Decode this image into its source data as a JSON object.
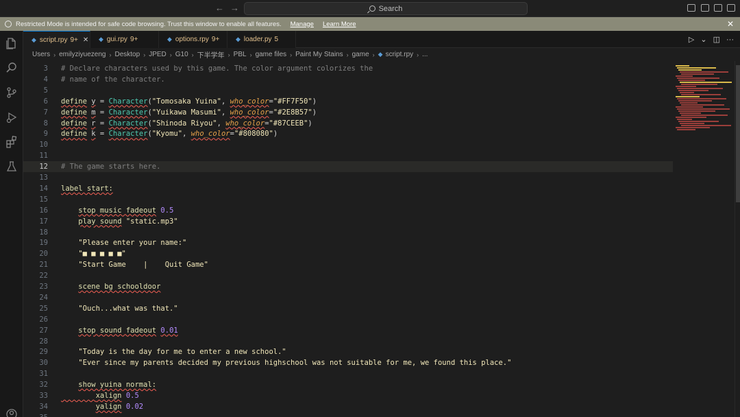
{
  "window": {
    "search_placeholder": "Search",
    "nav_back_glyph": "←",
    "nav_forward_glyph": "→"
  },
  "banner": {
    "message": "Restricted Mode is intended for safe code browsing. Trust this window to enable all features.",
    "manage_label": "Manage",
    "learn_more_label": "Learn More",
    "close_glyph": "✕",
    "color": "#8a8a78"
  },
  "activity_bar": {
    "icons": [
      "explorer-icon",
      "search-icon",
      "source-control-icon",
      "run-debug-icon",
      "extensions-icon",
      "testing-icon",
      "accounts-icon"
    ]
  },
  "tabs": [
    {
      "name": "script.rpy",
      "badge": "9+",
      "active": true,
      "close": "✕"
    },
    {
      "name": "gui.rpy",
      "badge": "9+",
      "active": false
    },
    {
      "name": "options.rpy",
      "badge": "9+",
      "active": false
    },
    {
      "name": "loader.py",
      "badge": "5",
      "active": false
    }
  ],
  "editor_actions": {
    "run_glyph": "▷",
    "dropdown_glyph": "⌄",
    "split_glyph": "◫",
    "more_glyph": "···"
  },
  "breadcrumb": [
    "Users",
    "emilyziyuezeng",
    "Desktop",
    "JPED",
    "G10",
    "下半学年",
    "PBL",
    "game files",
    "Paint My Stains",
    "game",
    "script.rpy",
    "..."
  ],
  "code": {
    "current_line": 12,
    "lines": [
      {
        "n": "3",
        "html": "<span class='t-cmt'># Declare characters used by this game. The color argument colorizes the</span>"
      },
      {
        "n": "4",
        "html": "<span class='t-cmt'># name of the character.</span>"
      },
      {
        "n": "5",
        "html": ""
      },
      {
        "n": "6",
        "html": "<span class='t-kw sq'>define</span> <span class='sq'>y</span> = <span class='t-cls sq'>Character</span>(<span class='t-str'>\"Tomosaka Yuina\"</span>, <span class='t-param sq'>who_color</span>=<span class='t-str'>\"#FF7F50\"</span>)"
      },
      {
        "n": "7",
        "html": "<span class='t-kw sq'>define</span> <span class='sq'>m</span> = <span class='t-cls sq'>Character</span>(<span class='t-str'>\"Yuikawa Masumi\"</span>, <span class='t-param sq'>who_color</span>=<span class='t-str'>\"#2E8B57\"</span>)"
      },
      {
        "n": "8",
        "html": "<span class='t-kw sq'>define</span> <span class='sq'>r</span> = <span class='t-cls sq'>Character</span>(<span class='t-str'>\"Shinoda Riyou\"</span>, <span class='t-param sq'>who_color</span>=<span class='t-str'>\"#87CEEB\"</span>)"
      },
      {
        "n": "9",
        "html": "<span class='t-kw sq'>define</span> <span class='sq'>k</span> = <span class='t-cls sq'>Character</span>(<span class='t-str'>\"Kyomu\"</span>, <span class='t-param sq'>who_color</span>=<span class='t-str'>\"#808080\"</span>)"
      },
      {
        "n": "10",
        "html": ""
      },
      {
        "n": "11",
        "html": ""
      },
      {
        "n": "12",
        "html": "<span class='t-cmt'># The game starts here.</span>"
      },
      {
        "n": "13",
        "html": ""
      },
      {
        "n": "14",
        "html": "<span class='t-kw sq'>label start:</span>"
      },
      {
        "n": "15",
        "html": ""
      },
      {
        "n": "16",
        "html": "    <span class='t-kw sq'>stop music fadeout</span> <span class='t-num'>0.5</span>"
      },
      {
        "n": "17",
        "html": "    <span class='t-kw sq'>play sound</span> <span class='t-str'>\"static.mp3\"</span>"
      },
      {
        "n": "18",
        "html": ""
      },
      {
        "n": "19",
        "html": "    <span class='t-str'>\"Please enter your name:\"</span>"
      },
      {
        "n": "20",
        "html": "    <span class='t-str'>\"■ ■ ■ ■ ■\"</span>"
      },
      {
        "n": "21",
        "html": "    <span class='t-str'>\"Start Game    |    Quit Game\"</span>"
      },
      {
        "n": "22",
        "html": ""
      },
      {
        "n": "23",
        "html": "    <span class='t-kw sq'>scene bg schooldoor</span>"
      },
      {
        "n": "24",
        "html": ""
      },
      {
        "n": "25",
        "html": "    <span class='t-str'>\"Ouch...what was that.\"</span>"
      },
      {
        "n": "26",
        "html": ""
      },
      {
        "n": "27",
        "html": "    <span class='t-kw sq'>stop sound fadeout</span> <span class='t-num sq'>0.01</span>"
      },
      {
        "n": "28",
        "html": ""
      },
      {
        "n": "29",
        "html": "    <span class='t-str'>\"Today is the day for me to enter a new school.\"</span>"
      },
      {
        "n": "30",
        "html": "    <span class='t-str'>\"Ever since my parents decided my previous highschool was not suitable for me, we found this place.\"</span>"
      },
      {
        "n": "31",
        "html": ""
      },
      {
        "n": "32",
        "html": "    <span class='t-kw sq'>show yuina normal:</span>"
      },
      {
        "n": "33",
        "html": "<span class='sq'>        </span><span class='t-kw sq'>xalign</span> <span class='t-num'>0.5</span>"
      },
      {
        "n": "34",
        "html": "        <span class='t-kw sq'>yalign</span> <span class='t-num'>0.02</span>"
      },
      {
        "n": "35",
        "html": ""
      }
    ]
  },
  "colors": {
    "accent": "#0078d4",
    "editor_bg": "#1e1e1e",
    "warning_badge": "#e2c08d",
    "squiggle": "#e05a4f"
  }
}
